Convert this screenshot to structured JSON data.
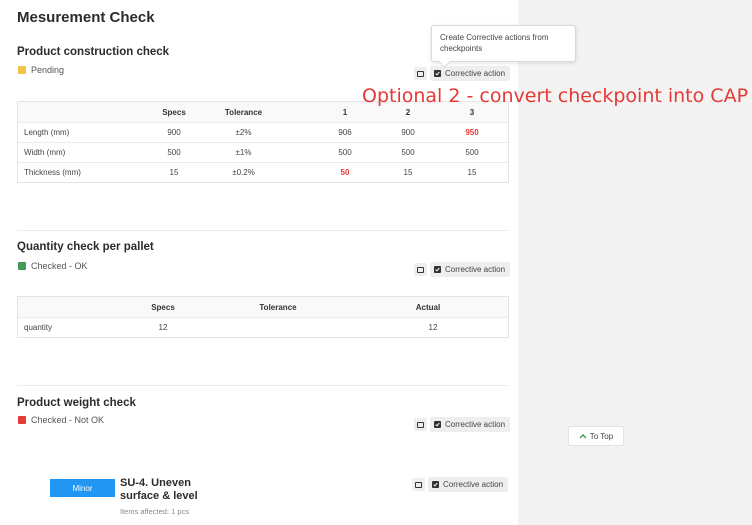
{
  "page": {
    "title": "Mesurement Check"
  },
  "sections": [
    {
      "title": "Product construction check",
      "status": "Pending",
      "status_color": "#f5c343",
      "ca_label": "Corrective action",
      "table": {
        "headers": [
          "",
          "Specs",
          "Tolerance",
          "1",
          "2",
          "3"
        ],
        "rows": [
          [
            "Length (mm)",
            "900",
            "±2%",
            "906",
            "900",
            "950"
          ],
          [
            "Width (mm)",
            "500",
            "±1%",
            "500",
            "500",
            "500"
          ],
          [
            "Thickness (mm)",
            "15",
            "±0.2%",
            "50",
            "15",
            "15"
          ]
        ]
      }
    },
    {
      "title": "Quantity check per pallet",
      "status": "Checked - OK",
      "status_color": "#3f9b57",
      "ca_label": "Corrective action",
      "table": {
        "headers": [
          "",
          "Specs",
          "Tolerance",
          "Actual"
        ],
        "rows": [
          [
            "quantity",
            "12",
            "",
            "12"
          ]
        ]
      }
    },
    {
      "title": "Product weight check",
      "status": "Checked - Not OK",
      "status_color": "#e53935",
      "ca_label": "Corrective action"
    }
  ],
  "tooltip": "Create Corrective actions from checkpoints",
  "annotation": "Optional 2 - convert checkpoint into CAP",
  "to_top": "To Top",
  "defect": {
    "severity": "Minor",
    "title": "SU-4. Uneven surface & level",
    "affected": "Items affected: 1 pcs",
    "ca_label": "Corrective action"
  },
  "colors": {
    "accent": "#2196f3",
    "error": "#e53935",
    "pending": "#f5c343",
    "ok": "#3f9b57"
  }
}
